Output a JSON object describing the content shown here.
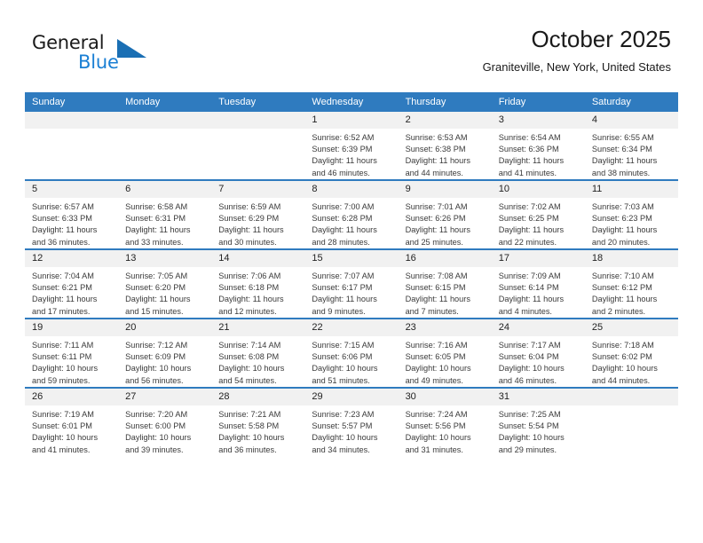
{
  "brand": {
    "name_part1": "General",
    "name_part2": "Blue",
    "triangle_color": "#1a6fb4"
  },
  "header": {
    "title": "October 2025",
    "location": "Graniteville, New York, United States"
  },
  "colors": {
    "header_blue": "#2f7bbf",
    "daynum_band": "#f1f1f1",
    "text": "#3a3a3a"
  },
  "weekdays": [
    "Sunday",
    "Monday",
    "Tuesday",
    "Wednesday",
    "Thursday",
    "Friday",
    "Saturday"
  ],
  "weeks": [
    [
      {
        "day": "",
        "sunrise": "",
        "sunset": "",
        "daylight": "",
        "daylight2": ""
      },
      {
        "day": "",
        "sunrise": "",
        "sunset": "",
        "daylight": "",
        "daylight2": ""
      },
      {
        "day": "",
        "sunrise": "",
        "sunset": "",
        "daylight": "",
        "daylight2": ""
      },
      {
        "day": "1",
        "sunrise": "Sunrise: 6:52 AM",
        "sunset": "Sunset: 6:39 PM",
        "daylight": "Daylight: 11 hours",
        "daylight2": "and 46 minutes."
      },
      {
        "day": "2",
        "sunrise": "Sunrise: 6:53 AM",
        "sunset": "Sunset: 6:38 PM",
        "daylight": "Daylight: 11 hours",
        "daylight2": "and 44 minutes."
      },
      {
        "day": "3",
        "sunrise": "Sunrise: 6:54 AM",
        "sunset": "Sunset: 6:36 PM",
        "daylight": "Daylight: 11 hours",
        "daylight2": "and 41 minutes."
      },
      {
        "day": "4",
        "sunrise": "Sunrise: 6:55 AM",
        "sunset": "Sunset: 6:34 PM",
        "daylight": "Daylight: 11 hours",
        "daylight2": "and 38 minutes."
      }
    ],
    [
      {
        "day": "5",
        "sunrise": "Sunrise: 6:57 AM",
        "sunset": "Sunset: 6:33 PM",
        "daylight": "Daylight: 11 hours",
        "daylight2": "and 36 minutes."
      },
      {
        "day": "6",
        "sunrise": "Sunrise: 6:58 AM",
        "sunset": "Sunset: 6:31 PM",
        "daylight": "Daylight: 11 hours",
        "daylight2": "and 33 minutes."
      },
      {
        "day": "7",
        "sunrise": "Sunrise: 6:59 AM",
        "sunset": "Sunset: 6:29 PM",
        "daylight": "Daylight: 11 hours",
        "daylight2": "and 30 minutes."
      },
      {
        "day": "8",
        "sunrise": "Sunrise: 7:00 AM",
        "sunset": "Sunset: 6:28 PM",
        "daylight": "Daylight: 11 hours",
        "daylight2": "and 28 minutes."
      },
      {
        "day": "9",
        "sunrise": "Sunrise: 7:01 AM",
        "sunset": "Sunset: 6:26 PM",
        "daylight": "Daylight: 11 hours",
        "daylight2": "and 25 minutes."
      },
      {
        "day": "10",
        "sunrise": "Sunrise: 7:02 AM",
        "sunset": "Sunset: 6:25 PM",
        "daylight": "Daylight: 11 hours",
        "daylight2": "and 22 minutes."
      },
      {
        "day": "11",
        "sunrise": "Sunrise: 7:03 AM",
        "sunset": "Sunset: 6:23 PM",
        "daylight": "Daylight: 11 hours",
        "daylight2": "and 20 minutes."
      }
    ],
    [
      {
        "day": "12",
        "sunrise": "Sunrise: 7:04 AM",
        "sunset": "Sunset: 6:21 PM",
        "daylight": "Daylight: 11 hours",
        "daylight2": "and 17 minutes."
      },
      {
        "day": "13",
        "sunrise": "Sunrise: 7:05 AM",
        "sunset": "Sunset: 6:20 PM",
        "daylight": "Daylight: 11 hours",
        "daylight2": "and 15 minutes."
      },
      {
        "day": "14",
        "sunrise": "Sunrise: 7:06 AM",
        "sunset": "Sunset: 6:18 PM",
        "daylight": "Daylight: 11 hours",
        "daylight2": "and 12 minutes."
      },
      {
        "day": "15",
        "sunrise": "Sunrise: 7:07 AM",
        "sunset": "Sunset: 6:17 PM",
        "daylight": "Daylight: 11 hours",
        "daylight2": "and 9 minutes."
      },
      {
        "day": "16",
        "sunrise": "Sunrise: 7:08 AM",
        "sunset": "Sunset: 6:15 PM",
        "daylight": "Daylight: 11 hours",
        "daylight2": "and 7 minutes."
      },
      {
        "day": "17",
        "sunrise": "Sunrise: 7:09 AM",
        "sunset": "Sunset: 6:14 PM",
        "daylight": "Daylight: 11 hours",
        "daylight2": "and 4 minutes."
      },
      {
        "day": "18",
        "sunrise": "Sunrise: 7:10 AM",
        "sunset": "Sunset: 6:12 PM",
        "daylight": "Daylight: 11 hours",
        "daylight2": "and 2 minutes."
      }
    ],
    [
      {
        "day": "19",
        "sunrise": "Sunrise: 7:11 AM",
        "sunset": "Sunset: 6:11 PM",
        "daylight": "Daylight: 10 hours",
        "daylight2": "and 59 minutes."
      },
      {
        "day": "20",
        "sunrise": "Sunrise: 7:12 AM",
        "sunset": "Sunset: 6:09 PM",
        "daylight": "Daylight: 10 hours",
        "daylight2": "and 56 minutes."
      },
      {
        "day": "21",
        "sunrise": "Sunrise: 7:14 AM",
        "sunset": "Sunset: 6:08 PM",
        "daylight": "Daylight: 10 hours",
        "daylight2": "and 54 minutes."
      },
      {
        "day": "22",
        "sunrise": "Sunrise: 7:15 AM",
        "sunset": "Sunset: 6:06 PM",
        "daylight": "Daylight: 10 hours",
        "daylight2": "and 51 minutes."
      },
      {
        "day": "23",
        "sunrise": "Sunrise: 7:16 AM",
        "sunset": "Sunset: 6:05 PM",
        "daylight": "Daylight: 10 hours",
        "daylight2": "and 49 minutes."
      },
      {
        "day": "24",
        "sunrise": "Sunrise: 7:17 AM",
        "sunset": "Sunset: 6:04 PM",
        "daylight": "Daylight: 10 hours",
        "daylight2": "and 46 minutes."
      },
      {
        "day": "25",
        "sunrise": "Sunrise: 7:18 AM",
        "sunset": "Sunset: 6:02 PM",
        "daylight": "Daylight: 10 hours",
        "daylight2": "and 44 minutes."
      }
    ],
    [
      {
        "day": "26",
        "sunrise": "Sunrise: 7:19 AM",
        "sunset": "Sunset: 6:01 PM",
        "daylight": "Daylight: 10 hours",
        "daylight2": "and 41 minutes."
      },
      {
        "day": "27",
        "sunrise": "Sunrise: 7:20 AM",
        "sunset": "Sunset: 6:00 PM",
        "daylight": "Daylight: 10 hours",
        "daylight2": "and 39 minutes."
      },
      {
        "day": "28",
        "sunrise": "Sunrise: 7:21 AM",
        "sunset": "Sunset: 5:58 PM",
        "daylight": "Daylight: 10 hours",
        "daylight2": "and 36 minutes."
      },
      {
        "day": "29",
        "sunrise": "Sunrise: 7:23 AM",
        "sunset": "Sunset: 5:57 PM",
        "daylight": "Daylight: 10 hours",
        "daylight2": "and 34 minutes."
      },
      {
        "day": "30",
        "sunrise": "Sunrise: 7:24 AM",
        "sunset": "Sunset: 5:56 PM",
        "daylight": "Daylight: 10 hours",
        "daylight2": "and 31 minutes."
      },
      {
        "day": "31",
        "sunrise": "Sunrise: 7:25 AM",
        "sunset": "Sunset: 5:54 PM",
        "daylight": "Daylight: 10 hours",
        "daylight2": "and 29 minutes."
      },
      {
        "day": "",
        "sunrise": "",
        "sunset": "",
        "daylight": "",
        "daylight2": ""
      }
    ]
  ]
}
